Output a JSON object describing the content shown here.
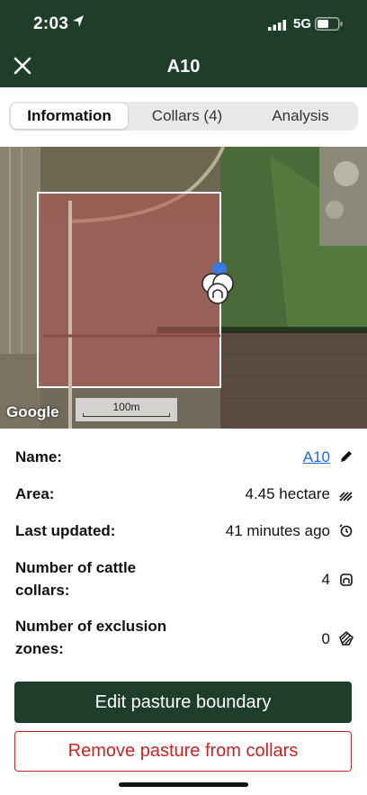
{
  "status_bar": {
    "time": "2:03",
    "network": "5G"
  },
  "header": {
    "title": "A10"
  },
  "tabs": [
    {
      "label": "Information",
      "active": true
    },
    {
      "label": "Collars (4)",
      "active": false
    },
    {
      "label": "Analysis",
      "active": false
    }
  ],
  "map": {
    "attribution": "Google",
    "scale_label": "100m"
  },
  "info": {
    "name_label": "Name:",
    "name_value": "A10",
    "area_label": "Area:",
    "area_value": "4.45 hectare",
    "updated_label": "Last updated:",
    "updated_value": "41 minutes ago",
    "collars_label_1": "Number of cattle",
    "collars_label_2": "collars:",
    "collars_value": "4",
    "zones_label_1": "Number of exclusion",
    "zones_label_2": "zones:",
    "zones_value": "0"
  },
  "actions": {
    "edit_label": "Edit pasture boundary",
    "remove_label": "Remove pasture from collars"
  },
  "colors": {
    "brand_green": "#1e3d2a",
    "link_blue": "#1a6bd6",
    "danger_red": "#cc2222"
  }
}
